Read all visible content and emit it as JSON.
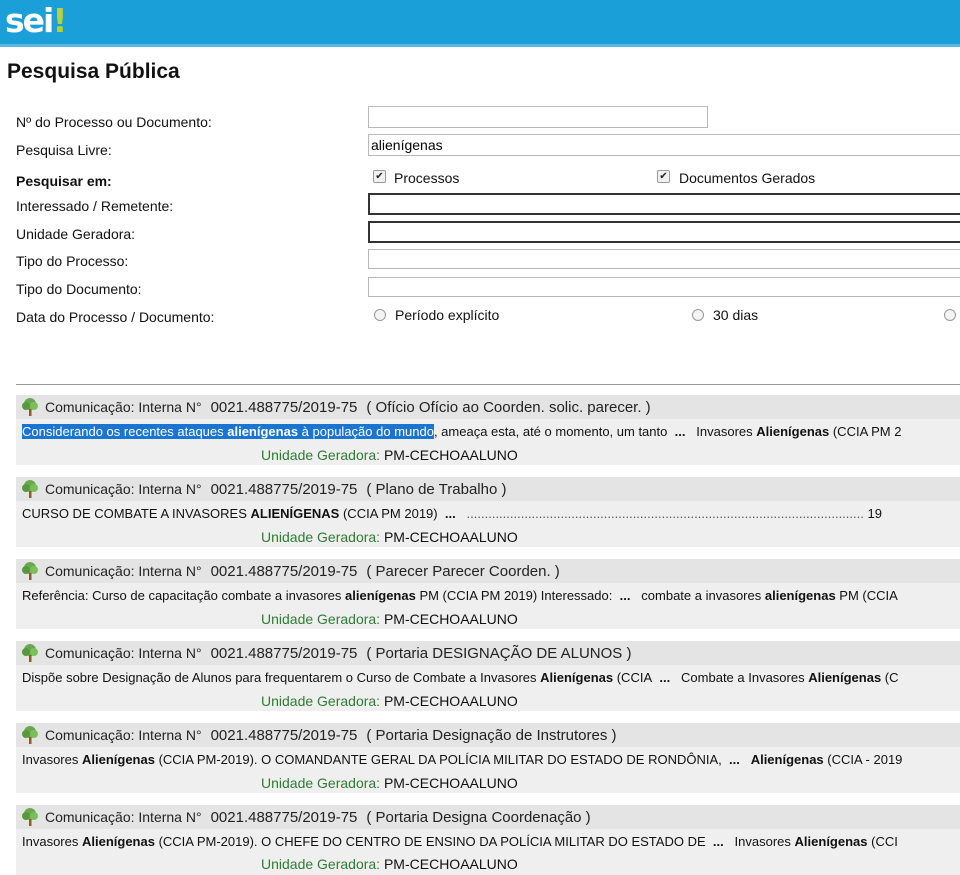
{
  "header": {
    "logo_text": "sei",
    "logo_accent": "!"
  },
  "page": {
    "title": "Pesquisa Pública"
  },
  "form": {
    "process_label": "Nº do Processo ou Documento:",
    "process_value": "",
    "free_search_label": "Pesquisa Livre:",
    "free_search_value": "alienígenas",
    "search_in_label": "Pesquisar em:",
    "opt_processos": "Processos",
    "opt_documentos": "Documentos Gerados",
    "interessado_label": "Interessado / Remetente:",
    "unidade_label": "Unidade Geradora:",
    "tipo_processo_label": "Tipo do Processo:",
    "tipo_documento_label": "Tipo do Documento:",
    "data_label": "Data do Processo / Documento:",
    "periodo_explicito": "Período explícito",
    "trinta_dias": "30 dias"
  },
  "results": [
    {
      "type": "Comunicação: Interna N°",
      "number": "0021.488775/2019-75",
      "doc": "( Ofício Ofício ao Coorden. solic. parecer. )",
      "snippet": {
        "sel1": "Considerando os recentes ataques ",
        "sel_bold": "alienígenas",
        "sel2": " à população do mundo",
        "rest": ", ameaça esta, até o momento, um tanto",
        "ellipsis": "...",
        "after1": "Invasores ",
        "after_bold": "Alienígenas",
        "after2": " (CCIA PM 2"
      },
      "unit_label": "Unidade Geradora:",
      "unit_value": "PM-CECHOAALUNO"
    },
    {
      "type": "Comunicação: Interna N°",
      "number": "0021.488775/2019-75",
      "doc": "( Plano de Trabalho )",
      "snippet": {
        "pre": "CURSO DE COMBATE A INVASORES ",
        "bold": "ALIENÍGENAS",
        "post": " (CCIA PM 2019)",
        "ellipsis": "...",
        "dots": "..............................................................................................................",
        "page": "19"
      },
      "unit_label": "Unidade Geradora:",
      "unit_value": "PM-CECHOAALUNO"
    },
    {
      "type": "Comunicação: Interna N°",
      "number": "0021.488775/2019-75",
      "doc": "( Parecer Parecer Coorden. )",
      "snippet": {
        "pre": "Referência: Curso de capacitação combate a invasores ",
        "bold": "alienígenas",
        "post": " PM (CCIA PM 2019) Interessado:",
        "ellipsis": "...",
        "after1": "combate a invasores ",
        "after_bold": "alienígenas",
        "after2": " PM (CCIA"
      },
      "unit_label": "Unidade Geradora:",
      "unit_value": "PM-CECHOAALUNO"
    },
    {
      "type": "Comunicação: Interna N°",
      "number": "0021.488775/2019-75",
      "doc": "( Portaria DESIGNAÇÃO DE ALUNOS )",
      "snippet": {
        "pre": "Dispõe sobre Designação de Alunos para frequentarem o Curso de Combate a Invasores ",
        "bold": "Alienígenas",
        "post": " (CCIA",
        "ellipsis": "...",
        "after1": "Combate a Invasores ",
        "after_bold": "Alienígenas",
        "after2": " (C"
      },
      "unit_label": "Unidade Geradora:",
      "unit_value": "PM-CECHOAALUNO"
    },
    {
      "type": "Comunicação: Interna N°",
      "number": "0021.488775/2019-75",
      "doc": "( Portaria Designação de Instrutores )",
      "snippet": {
        "pre": "Invasores ",
        "bold": "Alienígenas",
        "post": " (CCIA PM-2019). O COMANDANTE GERAL DA POLÍCIA MILITAR DO ESTADO DE RONDÔNIA,",
        "ellipsis": "...",
        "after1": "",
        "after_bold": "Alienígenas",
        "after2": " (CCIA - 2019"
      },
      "unit_label": "Unidade Geradora:",
      "unit_value": "PM-CECHOAALUNO"
    },
    {
      "type": "Comunicação: Interna N°",
      "number": "0021.488775/2019-75",
      "doc": "( Portaria Designa Coordenação )",
      "snippet": {
        "pre": "Invasores ",
        "bold": "Alienígenas",
        "post": " (CCIA PM-2019). O CHEFE DO CENTRO DE ENSINO DA POLÍCIA MILITAR DO ESTADO DE",
        "ellipsis": "...",
        "after1": "Invasores ",
        "after_bold": "Alienígenas",
        "after2": " (CCI"
      },
      "unit_label": "Unidade Geradora:",
      "unit_value": "PM-CECHOAALUNO"
    }
  ],
  "colors": {
    "header_bg": "#1a9fd8",
    "logo_accent": "#b4d335",
    "unit_label": "#2e7d32",
    "selection": "#1a75d2"
  }
}
